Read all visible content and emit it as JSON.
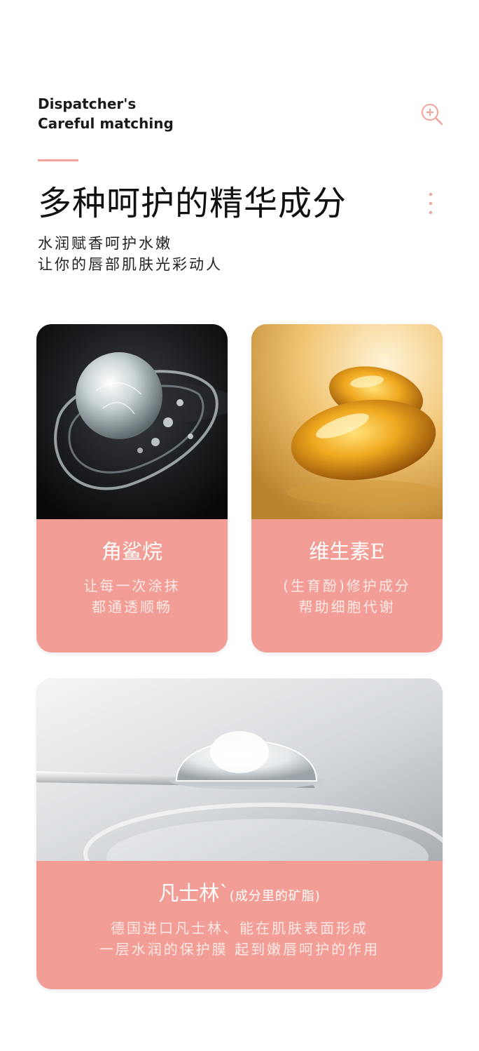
{
  "header": {
    "en_line1": "Dispatcher's",
    "en_line2": "Careful matching",
    "title": "多种呵护的精华成分",
    "subtitle_line1": "水润赋香呵护水嫩",
    "subtitle_line2": "让你的唇部肌肤光彩动人"
  },
  "cards": [
    {
      "title": "角鲨烷",
      "desc_line1": "让每一次涂抹",
      "desc_line2": "都通透顺畅",
      "image_icon": "water-droplet-photo"
    },
    {
      "title": "维生素E",
      "desc_line1": "(生育酚)修护成分",
      "desc_line2": "帮助细胞代谢",
      "image_icon": "vitamin-capsule-photo"
    },
    {
      "title": "凡士林`",
      "title_note": "(成分里的矿脂)",
      "desc_line1": "德国进口凡士林、能在肌肤表面形成",
      "desc_line2": "一层水润的保护膜  起到嫩唇呵护的作用",
      "image_icon": "gel-spatula-photo"
    }
  ],
  "colors": {
    "accent": "#f2a29a",
    "card_bg": "#f29d95",
    "title_text": "#111111"
  },
  "icons": {
    "zoom": "zoom-in-icon",
    "more": "more-vertical-icon"
  }
}
